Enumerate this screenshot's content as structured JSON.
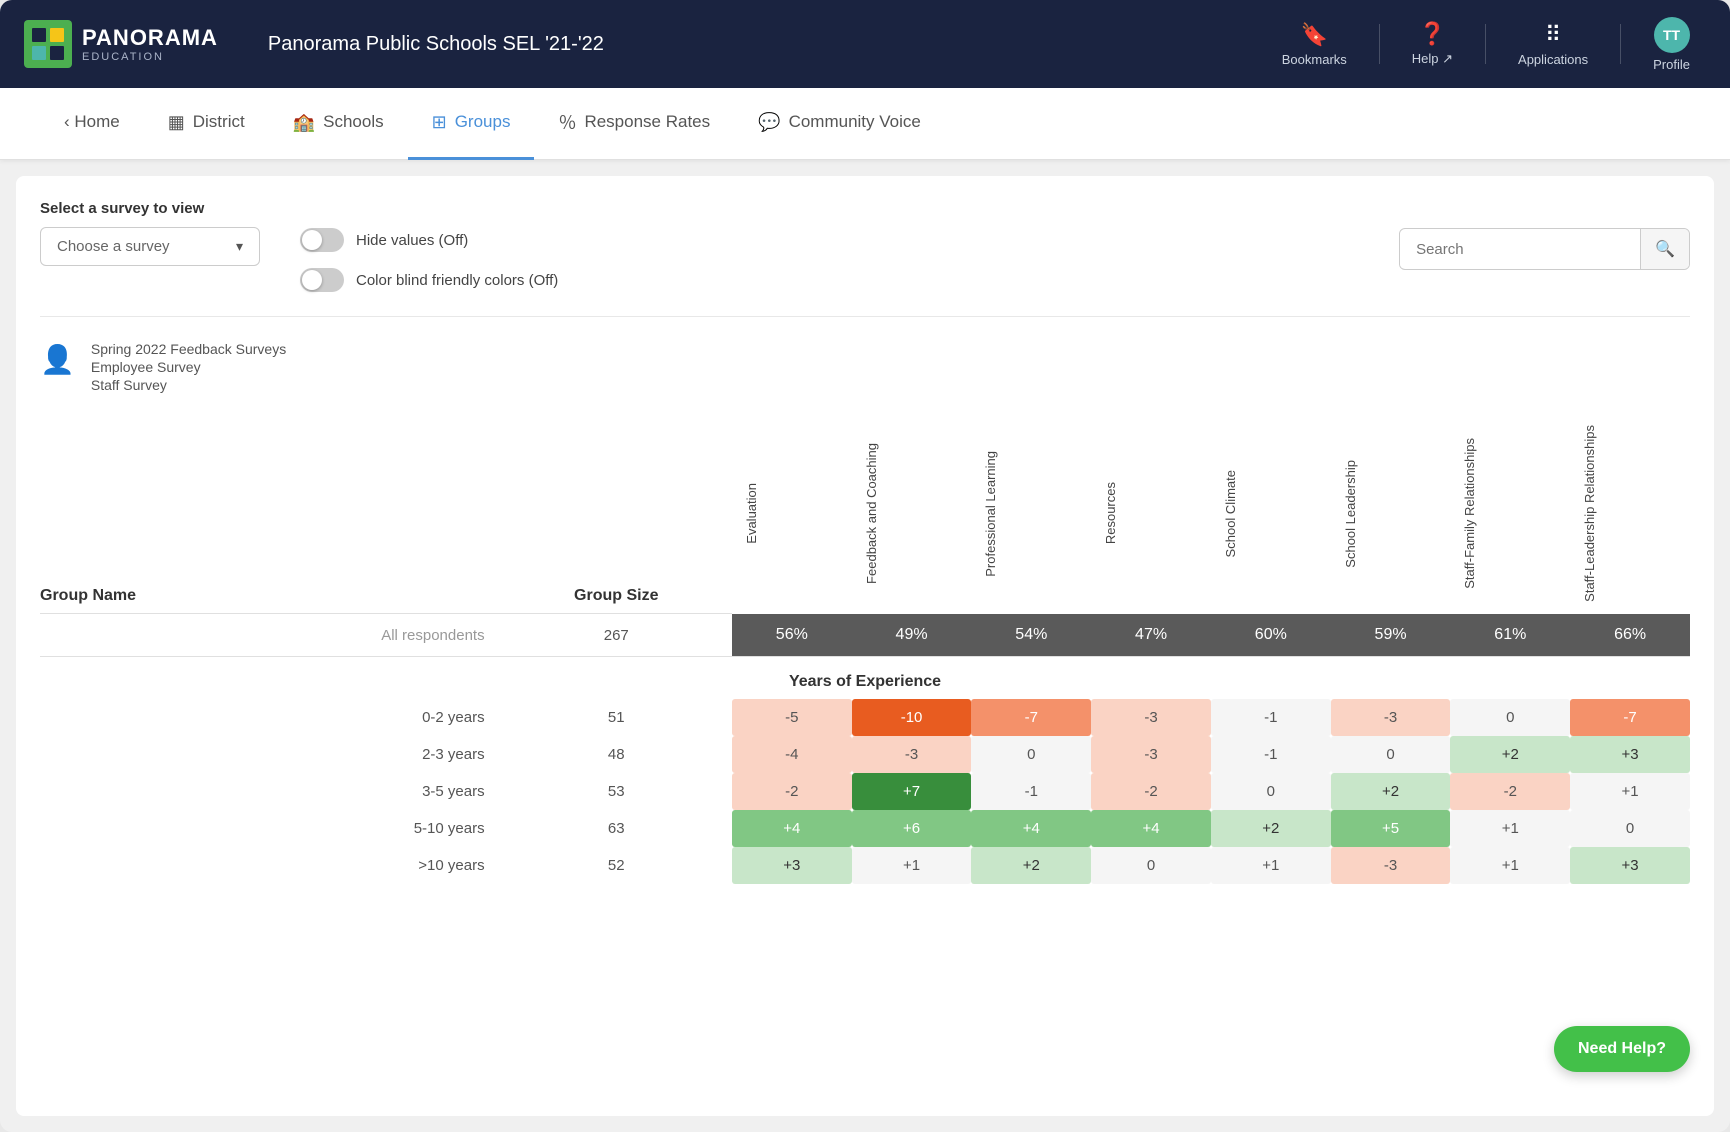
{
  "header": {
    "logo_name": "PANORAMA",
    "logo_sub": "EDUCATION",
    "title": "Panorama Public Schools SEL '21-'22",
    "bookmarks_label": "Bookmarks",
    "help_label": "Help ↗",
    "applications_label": "Applications",
    "profile_label": "Profile",
    "profile_initials": "TT"
  },
  "nav": {
    "home": "‹ Home",
    "district": "District",
    "schools": "Schools",
    "groups": "Groups",
    "response_rates": "Response Rates",
    "community_voice": "Community Voice"
  },
  "controls": {
    "survey_label": "Select a survey to view",
    "survey_placeholder": "Choose a survey",
    "hide_values_label": "Hide values (Off)",
    "color_blind_label": "Color blind friendly colors (Off)",
    "search_placeholder": "Search"
  },
  "survey_info": {
    "line1": "Spring 2022 Feedback Surveys",
    "line2": "Employee Survey",
    "line3": "Staff Survey"
  },
  "table": {
    "col_group_name": "Group Name",
    "col_group_size": "Group Size",
    "columns": [
      "Evaluation",
      "Feedback and Coaching",
      "Professional Learning",
      "Resources",
      "School Climate",
      "School Leadership",
      "Staff-Family Relationships",
      "Staff-Leadership Relationships"
    ],
    "all_respondents": {
      "label": "All respondents",
      "size": "267",
      "values": [
        "56%",
        "49%",
        "54%",
        "47%",
        "60%",
        "59%",
        "61%",
        "66%"
      ]
    },
    "section_header": "Years of Experience",
    "rows": [
      {
        "label": "0-2 years",
        "size": "51",
        "values": [
          "-5",
          "-10",
          "-7",
          "-3",
          "-1",
          "-3",
          "0",
          "-7"
        ],
        "colors": [
          "neg-light",
          "neg-strong",
          "neg-med",
          "neg-light",
          "neutral",
          "neg-light",
          "neutral",
          "neg-med"
        ]
      },
      {
        "label": "2-3 years",
        "size": "48",
        "values": [
          "-4",
          "-3",
          "0",
          "-3",
          "-1",
          "0",
          "+2",
          "+3"
        ],
        "colors": [
          "neg-light",
          "neg-light",
          "neutral",
          "neg-light",
          "neutral",
          "neutral",
          "pos-light",
          "pos-light"
        ]
      },
      {
        "label": "3-5 years",
        "size": "53",
        "values": [
          "-2",
          "+7",
          "-1",
          "-2",
          "0",
          "+2",
          "-2",
          "+1"
        ],
        "colors": [
          "neg-light",
          "pos-strong",
          "neutral",
          "neg-light",
          "neutral",
          "pos-light",
          "neg-light",
          "neutral"
        ]
      },
      {
        "label": "5-10 years",
        "size": "63",
        "values": [
          "+4",
          "+6",
          "+4",
          "+4",
          "+2",
          "+5",
          "+1",
          "0"
        ],
        "colors": [
          "pos-med",
          "pos-med",
          "pos-med",
          "pos-med",
          "pos-light",
          "pos-med",
          "neutral",
          "neutral"
        ]
      },
      {
        "label": ">10 years",
        "size": "52",
        "values": [
          "+3",
          "+1",
          "+2",
          "0",
          "+1",
          "-3",
          "+1",
          "+3"
        ],
        "colors": [
          "pos-light",
          "neutral",
          "pos-light",
          "neutral",
          "neutral",
          "neg-light",
          "neutral",
          "pos-light"
        ]
      }
    ]
  },
  "need_help_label": "Need Help?"
}
